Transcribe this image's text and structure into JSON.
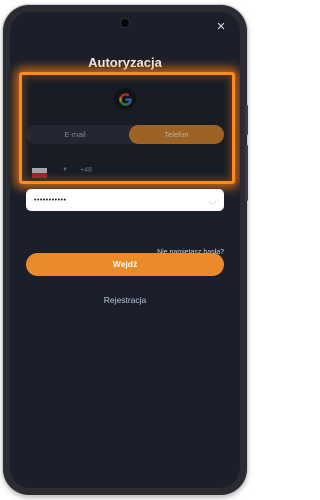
{
  "modal": {
    "title": "Autoryzacja",
    "close_icon": "×"
  },
  "auth_tabs": [
    {
      "label": "E-mail",
      "selected": false
    },
    {
      "label": "Telefon",
      "selected": true
    }
  ],
  "phone": {
    "country_code": "+48"
  },
  "password": {
    "value": "•••••••••••",
    "visibility_icon": "eye-off-icon"
  },
  "links": {
    "forgot_password": "Nie pamiętasz hasła?",
    "register": "Rejestracja"
  },
  "buttons": {
    "login": "Wejdź"
  },
  "colors": {
    "accent": "#ea8a2a",
    "highlight": "#ff8a1e",
    "background": "#1b1f2a"
  }
}
